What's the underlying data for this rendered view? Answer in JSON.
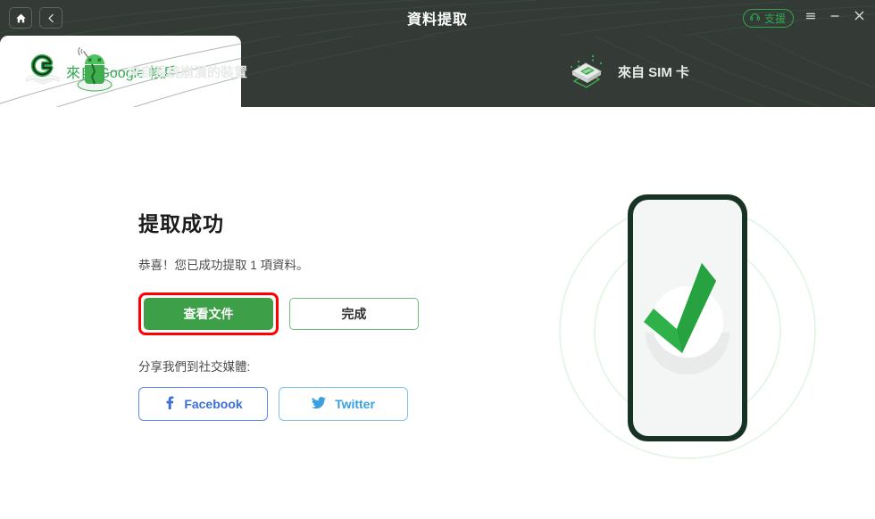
{
  "window": {
    "title": "資料提取",
    "home_icon": "home-icon",
    "back_icon": "back-chevron-icon",
    "support_label": "支援",
    "support_icon": "headset-icon",
    "menu_icon": "hamburger-menu-icon",
    "minimize_icon": "minimize-icon",
    "close_icon": "close-icon",
    "header_bg": "#343b37",
    "accent_green": "#2fa84f"
  },
  "tabs": [
    {
      "label": "來自系統崩潰的裝置",
      "icon": "broken-android-icon",
      "active": false
    },
    {
      "label": "來自 Google 帳戶",
      "icon": "google-g-icon",
      "active": true
    },
    {
      "label": "來自 SIM 卡",
      "icon": "sim-card-icon",
      "active": false
    }
  ],
  "main": {
    "heading": "提取成功",
    "subtext": "恭喜！您已成功提取 1 項資料。",
    "view_files_label": "查看文件",
    "done_label": "完成",
    "share_label": "分享我們到社交媒體:",
    "facebook_label": "Facebook",
    "twitter_label": "Twitter",
    "facebook_icon": "facebook-f-icon",
    "twitter_icon": "twitter-bird-icon",
    "highlight_color": "#ff0000",
    "primary_color": "#3d9f47",
    "facebook_color": "#3b6fd4",
    "twitter_color": "#3aa0e0"
  },
  "illustration": {
    "name": "phone-success-checkmark-illustration",
    "phone_frame_color": "#173323",
    "screen_color": "#f4f5f5",
    "check_color": "#2fb14a",
    "ring_color": "#e6e9e8",
    "wave_color": "#e0f5e3"
  }
}
